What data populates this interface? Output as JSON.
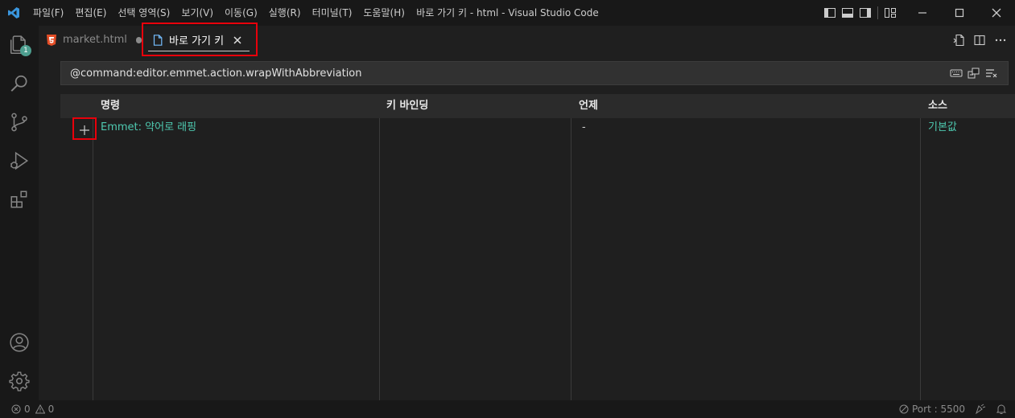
{
  "titlebar": {
    "window_title": "바로 가기 키 - html - Visual Studio Code",
    "menu": [
      "파일(F)",
      "편집(E)",
      "선택 영역(S)",
      "보기(V)",
      "이동(G)",
      "실행(R)",
      "터미널(T)",
      "도움말(H)"
    ]
  },
  "activity": {
    "explorer_badge": "1"
  },
  "tabs": [
    {
      "label": "market.html",
      "icon": "html5-icon"
    },
    {
      "label": "바로 가기 키",
      "icon": "file-icon"
    }
  ],
  "search": {
    "value": "@command:editor.emmet.action.wrapWithAbbreviation"
  },
  "table": {
    "headers": [
      "명령",
      "키 바인딩",
      "언제",
      "소스"
    ],
    "rows": [
      {
        "command_prefix": "Emmet: ",
        "command": "약어로 래핑",
        "keybinding": "",
        "when": "-",
        "source": "기본값"
      }
    ]
  },
  "status": {
    "errors": "0",
    "warnings": "0",
    "port": "Port : 5500"
  },
  "colors": {
    "highlight": "#e8000b",
    "accent": "#4ec9b0",
    "badge": "#4d9e8f"
  }
}
